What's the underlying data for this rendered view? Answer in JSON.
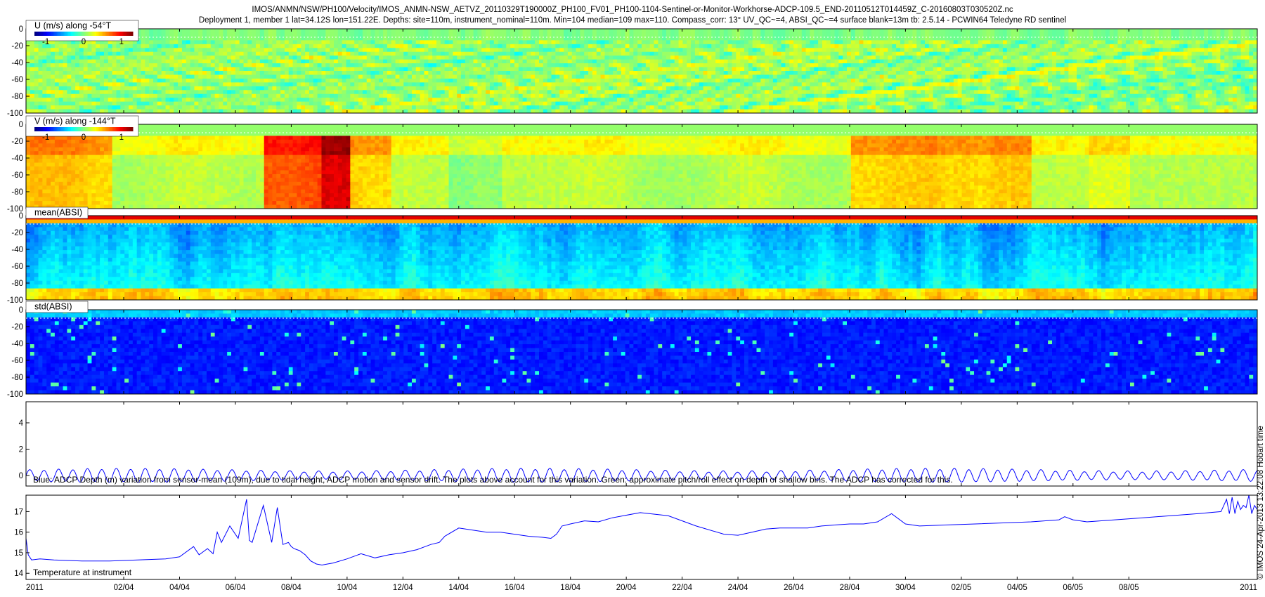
{
  "title_line1": "IMOS/ANMN/NSW/PH100/Velocity/IMOS_ANMN-NSW_AETVZ_20110329T190000Z_PH100_FV01_PH100-1104-Sentinel-or-Monitor-Workhorse-ADCP-109.5_END-20110512T014459Z_C-20160803T030520Z.nc",
  "title_line2": "Deployment 1, member 1 lat=34.12S lon=151.22E. Depths: site=110m, instrument_nominal=110m. Min=104 median=109 max=110. Compass_corr: 13° UV_QC~=4, ABSI_QC~=4 surface blank=13m tb: 2.5.14 - PCWIN64 Teledyne RD sentinel",
  "side_label": "© IMOS 24-Apr-2013 13:22:08 Hobart time",
  "chart_data": [
    {
      "type": "heatmap",
      "title": "U (m/s) along -54°T",
      "colorbar_ticks": [
        "-1",
        "0",
        "1"
      ],
      "clim": [
        -1.3,
        1.3
      ],
      "yticks": [
        "0",
        "-20",
        "-40",
        "-60",
        "-80",
        "-100"
      ],
      "ylim": [
        -100,
        0
      ]
    },
    {
      "type": "heatmap",
      "title": "V (m/s) along -144°T",
      "colorbar_ticks": [
        "-1",
        "0",
        "1"
      ],
      "clim": [
        -1.3,
        1.3
      ],
      "yticks": [
        "0",
        "-20",
        "-40",
        "-60",
        "-80",
        "-100"
      ],
      "ylim": [
        -100,
        0
      ]
    },
    {
      "type": "heatmap",
      "title": "mean(ABSI)",
      "yticks": [
        "0",
        "-20",
        "-40",
        "-60",
        "-80",
        "-100"
      ],
      "ylim": [
        -100,
        0
      ]
    },
    {
      "type": "heatmap",
      "title": "std(ABSI)",
      "yticks": [
        "0",
        "-20",
        "-40",
        "-60",
        "-80",
        "-100"
      ],
      "ylim": [
        -100,
        0
      ]
    },
    {
      "type": "line",
      "note": "Blue: ADCP Depth (m) variation from sensor-mean (109m), due to tidal height, ADCP motion and sensor drift. The plots above account for this variation. Green: approximate pitch/roll effect on depth of shallow bins. The ADCP has corrected for this.",
      "yticks": [
        "0",
        "2",
        "4"
      ],
      "ylim": [
        -0.8,
        5.6
      ],
      "series": [
        {
          "color": "#0000ff",
          "amplitude": 0.4,
          "tidal_period_days": 0.5175,
          "mean": 0
        }
      ]
    },
    {
      "type": "line",
      "note": "Temperature at instrument",
      "yticks": [
        "14",
        "15",
        "16",
        "17"
      ],
      "ylim": [
        13.7,
        17.8
      ],
      "series": [
        {
          "color": "#0000ff",
          "x_days": [
            0,
            0.08,
            0.2,
            0.5,
            1,
            2,
            3,
            4,
            5,
            5.5,
            6,
            6.2,
            6.5,
            6.7,
            6.85,
            7.0,
            7.3,
            7.6,
            7.9,
            8.0,
            8.1,
            8.5,
            8.8,
            9.0,
            9.2,
            9.4,
            9.5,
            9.6,
            9.8,
            10.0,
            10.2,
            10.4,
            10.6,
            10.8,
            11.0,
            11.5,
            12,
            12.5,
            13,
            13.5,
            14,
            14.3,
            14.5,
            14.8,
            15,
            15.5,
            16,
            16.5,
            17,
            17.5,
            18,
            18.5,
            18.8,
            19,
            19.2,
            19.5,
            20,
            20.5,
            21,
            22,
            23,
            24,
            25,
            25.5,
            26,
            26.5,
            27,
            27.5,
            28,
            28.5,
            29,
            29.5,
            30,
            30.5,
            31,
            31.5,
            32,
            33,
            34,
            35,
            36,
            37,
            37.2,
            37.5,
            38,
            39,
            40,
            41,
            42,
            42.8,
            43,
            43.1,
            43.2,
            43.3,
            43.4,
            43.5,
            43.6,
            43.7,
            43.8,
            43.9,
            44.0,
            44.1
          ],
          "y": [
            15.7,
            14.9,
            14.65,
            14.7,
            14.65,
            14.6,
            14.6,
            14.65,
            14.7,
            14.8,
            15.3,
            14.9,
            15.2,
            14.95,
            16.0,
            15.5,
            16.3,
            15.7,
            17.6,
            15.6,
            15.5,
            17.3,
            15.5,
            17.2,
            15.4,
            15.5,
            15.3,
            15.2,
            15.1,
            14.9,
            14.6,
            14.45,
            14.4,
            14.45,
            14.5,
            14.7,
            14.95,
            14.75,
            14.9,
            15.0,
            15.15,
            15.3,
            15.4,
            15.5,
            15.8,
            16.2,
            16.1,
            16.0,
            16.0,
            15.9,
            15.8,
            15.75,
            15.7,
            15.9,
            16.3,
            16.4,
            16.55,
            16.5,
            16.7,
            16.95,
            16.8,
            16.3,
            15.9,
            15.85,
            16.0,
            16.15,
            16.2,
            16.2,
            16.2,
            16.3,
            16.35,
            16.4,
            16.4,
            16.5,
            16.9,
            16.4,
            16.3,
            16.35,
            16.4,
            16.45,
            16.5,
            16.6,
            16.75,
            16.6,
            16.5,
            16.6,
            16.7,
            16.8,
            16.9,
            17.0,
            17.6,
            16.9,
            17.7,
            16.9,
            17.5,
            17.1,
            17.3,
            17.2,
            17.8,
            16.9,
            17.3,
            17.1
          ]
        }
      ]
    }
  ],
  "x_axis": {
    "days_total": 44.1,
    "ticks": [
      {
        "day": 0,
        "label": "2011"
      },
      {
        "day": 3.5,
        "label": "02/04"
      },
      {
        "day": 5.5,
        "label": "04/04"
      },
      {
        "day": 7.5,
        "label": "06/04"
      },
      {
        "day": 9.5,
        "label": "08/04"
      },
      {
        "day": 11.5,
        "label": "10/04"
      },
      {
        "day": 13.5,
        "label": "12/04"
      },
      {
        "day": 15.5,
        "label": "14/04"
      },
      {
        "day": 17.5,
        "label": "16/04"
      },
      {
        "day": 19.5,
        "label": "18/04"
      },
      {
        "day": 21.5,
        "label": "20/04"
      },
      {
        "day": 23.5,
        "label": "22/04"
      },
      {
        "day": 25.5,
        "label": "24/04"
      },
      {
        "day": 27.5,
        "label": "26/04"
      },
      {
        "day": 29.5,
        "label": "28/04"
      },
      {
        "day": 31.5,
        "label": "30/04"
      },
      {
        "day": 33.5,
        "label": "02/05"
      },
      {
        "day": 35.5,
        "label": "04/05"
      },
      {
        "day": 37.5,
        "label": "06/05"
      },
      {
        "day": 39.5,
        "label": "08/05"
      },
      {
        "day": 44.1,
        "label": "2011"
      }
    ]
  }
}
